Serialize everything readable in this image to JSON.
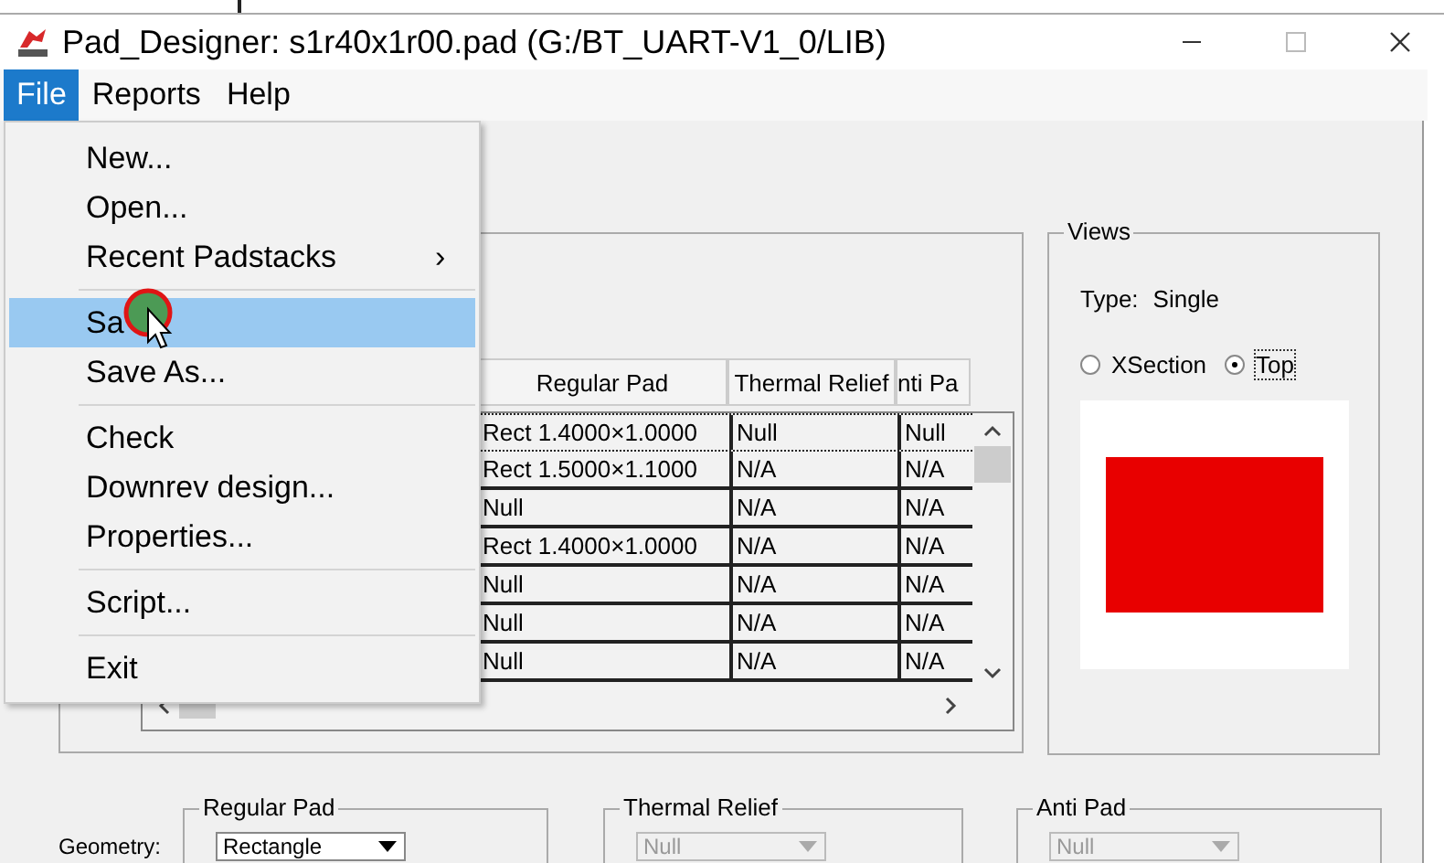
{
  "window": {
    "title": "Pad_Designer: s1r40x1r00.pad (G:/BT_UART-V1_0/LIB)"
  },
  "menu_bar": [
    {
      "label": "File",
      "selected": true
    },
    {
      "label": "Reports",
      "selected": false
    },
    {
      "label": "Help",
      "selected": false
    }
  ],
  "file_menu": [
    {
      "kind": "item",
      "label": "New...",
      "selected": false
    },
    {
      "kind": "item",
      "label": "Open...",
      "selected": false
    },
    {
      "kind": "submenu",
      "label": "Recent Padstacks",
      "arrow": "›",
      "selected": false
    },
    {
      "kind": "separator"
    },
    {
      "kind": "item",
      "label": "Sa",
      "selected": true
    },
    {
      "kind": "item",
      "label": "Save As...",
      "selected": false
    },
    {
      "kind": "separator"
    },
    {
      "kind": "item",
      "label": "Check",
      "selected": false
    },
    {
      "kind": "item",
      "label": "Downrev design...",
      "selected": false
    },
    {
      "kind": "item",
      "label": "Properties...",
      "selected": false
    },
    {
      "kind": "separator"
    },
    {
      "kind": "item",
      "label": "Script...",
      "selected": false
    },
    {
      "kind": "separator"
    },
    {
      "kind": "item",
      "label": "Exit",
      "selected": false
    }
  ],
  "table": {
    "columns": [
      "Regular Pad",
      "Thermal Relief",
      "nti Pa"
    ],
    "rows": [
      [
        "Rect 1.4000×1.0000",
        "Null",
        "Null"
      ],
      [
        "Rect 1.5000×1.1000",
        "N/A",
        "N/A"
      ],
      [
        "Null",
        "N/A",
        "N/A"
      ],
      [
        "Rect 1.4000×1.0000",
        "N/A",
        "N/A"
      ],
      [
        "Null",
        "N/A",
        "N/A"
      ],
      [
        "Null",
        "N/A",
        "N/A"
      ],
      [
        "Null",
        "N/A",
        "N/A"
      ]
    ]
  },
  "views": {
    "title": "Views",
    "type_label": "Type:",
    "type_value": "Single",
    "options": [
      {
        "label": "XSection",
        "selected": false
      },
      {
        "label": "Top",
        "selected": true
      }
    ]
  },
  "geometry_label": "Geometry:",
  "pad_groups": [
    {
      "title": "Regular Pad",
      "value": "Rectangle",
      "disabled": false
    },
    {
      "title": "Thermal Relief",
      "value": "Null",
      "disabled": true
    },
    {
      "title": "Anti Pad",
      "value": "Null",
      "disabled": true
    }
  ]
}
